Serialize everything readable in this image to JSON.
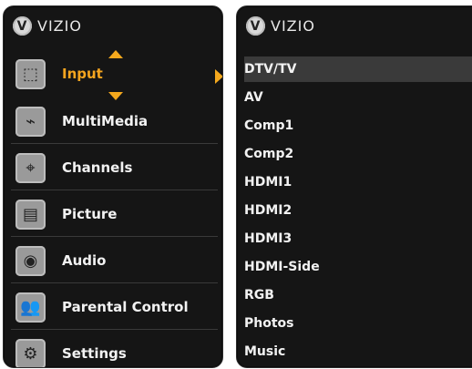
{
  "brand": {
    "name": "VIZIO"
  },
  "left_menu": {
    "items": [
      {
        "label": "Input",
        "icon": "input-icon",
        "selected": true
      },
      {
        "label": "MultiMedia",
        "icon": "usb-icon",
        "selected": false
      },
      {
        "label": "Channels",
        "icon": "antenna-icon",
        "selected": false
      },
      {
        "label": "Picture",
        "icon": "picture-icon",
        "selected": false
      },
      {
        "label": "Audio",
        "icon": "speaker-icon",
        "selected": false
      },
      {
        "label": "Parental Control",
        "icon": "parental-icon",
        "selected": false
      },
      {
        "label": "Settings",
        "icon": "settings-icon",
        "selected": false
      }
    ]
  },
  "submenu": {
    "items": [
      {
        "label": "DTV/TV",
        "selected": true
      },
      {
        "label": "AV",
        "selected": false
      },
      {
        "label": "Comp1",
        "selected": false
      },
      {
        "label": "Comp2",
        "selected": false
      },
      {
        "label": "HDMI1",
        "selected": false
      },
      {
        "label": "HDMI2",
        "selected": false
      },
      {
        "label": "HDMI3",
        "selected": false
      },
      {
        "label": "HDMI-Side",
        "selected": false
      },
      {
        "label": "RGB",
        "selected": false
      },
      {
        "label": "Photos",
        "selected": false
      },
      {
        "label": "Music",
        "selected": false
      }
    ]
  },
  "colors": {
    "panel_bg": "#151515",
    "accent": "#f4a81d",
    "selected_label": "#f5a51f",
    "text": "#f2f2f2",
    "selected_row": "#3a3a3a"
  }
}
